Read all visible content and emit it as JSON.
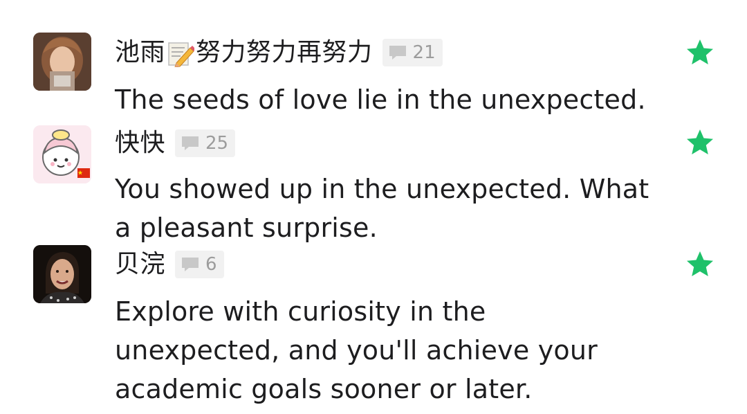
{
  "comments": [
    {
      "username_a": "池雨",
      "username_b": "努力努力再努力",
      "reply_count": "21",
      "text": "The seeds of love lie in the unexpected.",
      "starred": true
    },
    {
      "username": "快快",
      "reply_count": "25",
      "text_line1": "You showed up in the unexpected. What",
      "text_line2": "a pleasant surprise.",
      "starred": true
    },
    {
      "username": "贝浣",
      "reply_count": "6",
      "text_line1": "Explore with curiosity in the",
      "text_line2": "unexpected, and you'll achieve your",
      "text_line3": "academic goals sooner or later.",
      "starred": true
    }
  ],
  "icons": {
    "reply": "comment-bubble-icon",
    "star": "star-icon",
    "pencil": "memo-pencil-icon"
  },
  "colors": {
    "star": "#1fc16a",
    "badge_bg": "#f1f1f1",
    "badge_text": "#9c9c9c",
    "text": "#1d1d1f"
  }
}
